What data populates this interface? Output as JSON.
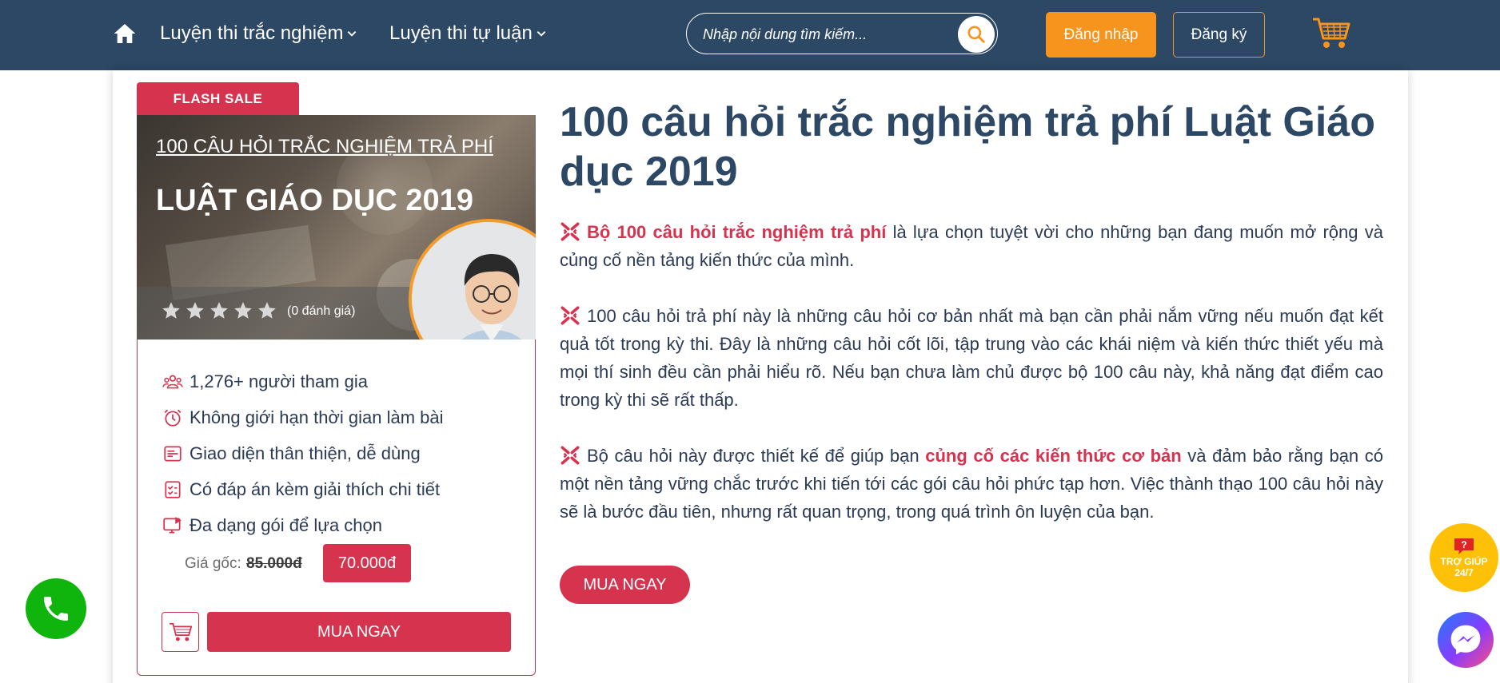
{
  "header": {
    "nav": [
      {
        "label": "Luyện thi trắc nghiệm"
      },
      {
        "label": "Luyện thi tự luận"
      }
    ],
    "search": {
      "placeholder": "Nhập nội dung tìm kiếm..."
    },
    "login_label": "Đăng nhập",
    "register_label": "Đăng ký"
  },
  "card": {
    "flash_label": "FLASH SALE",
    "banner_subtitle": "100 CÂU HỎI TRẮC NGHIỆM TRẢ PHÍ",
    "banner_title": "LUẬT GIÁO DỤC 2019",
    "rating_text": "(0 đánh giá)",
    "rating_value": 0,
    "rating_max": 5,
    "features": [
      {
        "icon": "users-icon",
        "label": "1,276+ người tham gia"
      },
      {
        "icon": "alarm-clock-icon",
        "label": "Không giới hạn thời gian làm bài"
      },
      {
        "icon": "interface-icon",
        "label": "Giao diện thân thiện, dễ dùng"
      },
      {
        "icon": "checklist-icon",
        "label": "Có đáp án kèm giải thích chi tiết"
      },
      {
        "icon": "video-monitor-icon",
        "label": "Đa dạng gói để lựa chọn"
      }
    ],
    "price_label": "Giá gốc:",
    "price_old": "85.000đ",
    "price_new": "70.000đ",
    "buy_label": "MUA NGAY"
  },
  "content": {
    "title": "100 câu hỏi trắc nghiệm trả phí Luật Giáo dục 2019",
    "p1_highlight": "Bộ 100 câu hỏi trắc nghiệm trả phí",
    "p1_rest": " là lựa chọn tuyệt vời cho những bạn đang muốn mở rộng và củng cố nền tảng kiến thức của mình.",
    "p2": "100 câu hỏi trả phí này là những câu hỏi cơ bản nhất mà bạn cần phải nắm vững nếu muốn đạt kết quả tốt trong kỳ thi. Đây là những câu hỏi cốt lõi, tập trung vào các khái niệm và kiến thức thiết yếu mà mọi thí sinh đều cần phải hiểu rõ. Nếu bạn chưa làm chủ được bộ 100 câu này, khả năng đạt điểm cao trong kỳ thi sẽ rất thấp.",
    "p3_before": "Bộ câu hỏi này được thiết kế để giúp bạn ",
    "p3_highlight": "củng cố các kiến thức cơ bản",
    "p3_after": " và đảm bảo rằng bạn có một nền tảng vững chắc trước khi tiến tới các gói câu hỏi phức tạp hơn. Việc thành thạo 100 câu hỏi này sẽ là bước đầu tiên, nhưng rất quan trọng, trong quá trình ôn luyện của bạn.",
    "buy_label": "MUA NGAY"
  },
  "floating": {
    "help_label": "TRỢ GIÚP 24/7"
  },
  "colors": {
    "header_bg": "#2c4865",
    "accent_red": "#d6334f",
    "accent_orange": "#f7941d",
    "title_blue": "#2c4865"
  }
}
